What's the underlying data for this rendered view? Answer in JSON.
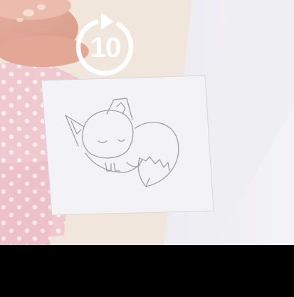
{
  "player": {
    "replay_button": {
      "seconds": "10",
      "icon": "replay-10-icon",
      "color": "#ffffff"
    }
  },
  "colors": {
    "letterbox": "#000000",
    "paper": "#f3f2f4",
    "sketch_line": "#9a9a9f"
  }
}
